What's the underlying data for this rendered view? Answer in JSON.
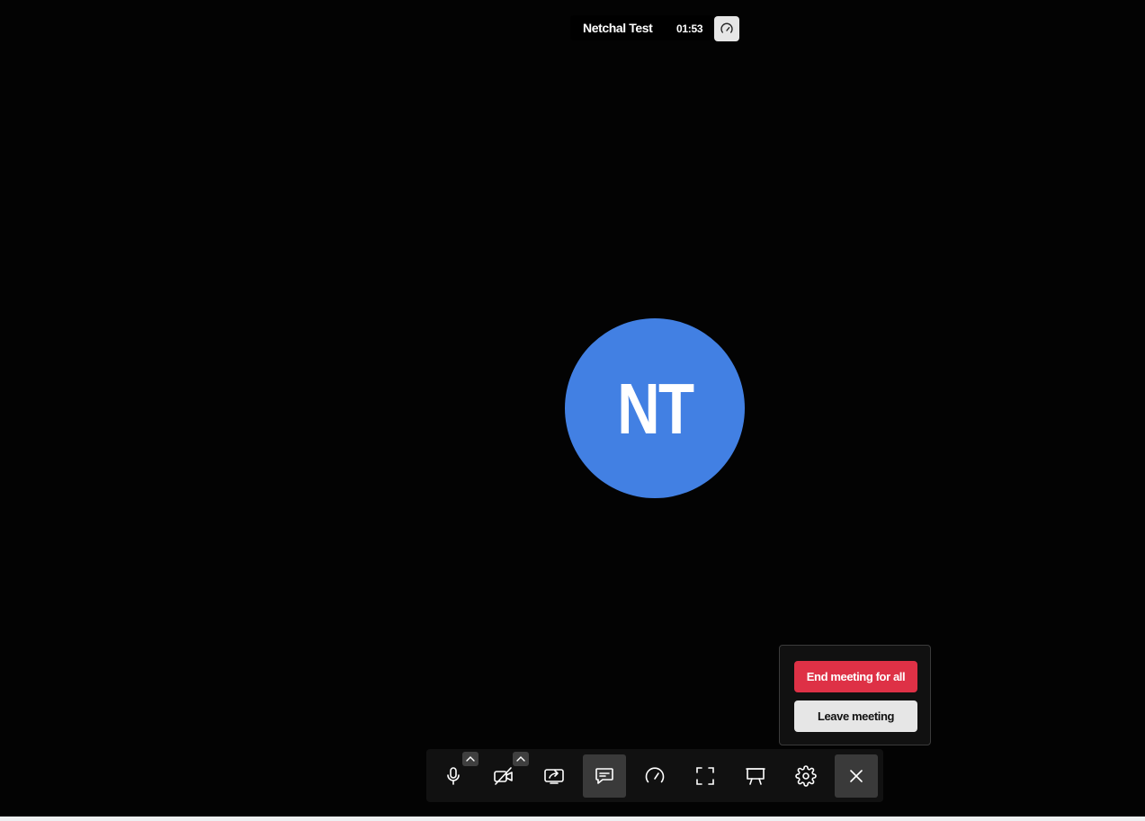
{
  "meeting": {
    "name": "Netchal Test",
    "elapsed": "01:53"
  },
  "participant": {
    "initials": "NT",
    "avatar_color": "#4280e3"
  },
  "leave_popup": {
    "end_for_all_label": "End meeting for all",
    "leave_label": "Leave meeting",
    "end_color": "#de3146"
  },
  "toolbar": {
    "buttons": [
      {
        "icon": "microphone-icon",
        "has_options_caret": true
      },
      {
        "icon": "camera-off-icon",
        "has_options_caret": true
      },
      {
        "icon": "share-screen-icon"
      },
      {
        "icon": "chat-icon",
        "active": true
      },
      {
        "icon": "speedometer-icon"
      },
      {
        "icon": "fullscreen-icon"
      },
      {
        "icon": "whiteboard-icon"
      },
      {
        "icon": "gear-icon"
      },
      {
        "icon": "close-icon",
        "active": true
      }
    ]
  }
}
